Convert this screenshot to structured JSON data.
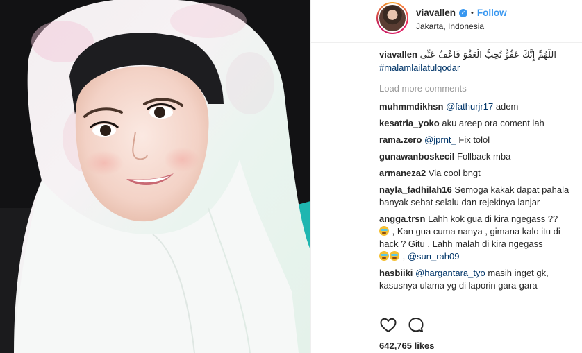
{
  "post": {
    "username": "viavallen",
    "verified_icon": "verified-badge-icon",
    "separator": "•",
    "follow_label": "Follow",
    "location": "Jakarta, Indonesia",
    "accent_color": "#3897f0"
  },
  "caption": {
    "user": "viavallen",
    "text": "اللَّهُمَّ إِنَّكَ عَفُوٌّ تُحِبُّ الْعَفْوَ فَاعْفُ عَنِّى",
    "hashtag": "#malamlailatulqodar"
  },
  "load_more_label": "Load more comments",
  "comments": [
    {
      "user": "muhmmdikhsn",
      "mention": "@fathurjr17",
      "text": " adem"
    },
    {
      "user": "kesatria_yoko",
      "mention": "",
      "text": "aku areep ora coment lah"
    },
    {
      "user": "rama.zero",
      "mention": "@jprnt_",
      "text": " Fix tolol"
    },
    {
      "user": "gunawanboskecil",
      "mention": "",
      "text": "Follback mba"
    },
    {
      "user": "armaneza2",
      "mention": "",
      "text": "Via cool bngt"
    },
    {
      "user": "nayla_fadhilah16",
      "mention": "",
      "text": "Semoga kakak dapat pahala banyak sehat selalu dan rejekinya lanjar"
    }
  ],
  "comment_angga": {
    "user": "angga.trsn",
    "text1": "Lahh kok gua di kira ngegass ??",
    "text2": " , Kan gua cuma nanya , gimana kalo itu di hack ? Gitu . Lahh malah di kira ngegass",
    "text3": " , ",
    "mention": "@sun_rah09"
  },
  "comment_hasbiiki": {
    "user": "hasbiiki",
    "mention": "@hargantara_tyo",
    "text": " masih inget gk, kasusnya ulama yg di laporin gara-gara"
  },
  "actions": {
    "like_icon": "heart-icon",
    "comment_icon": "comment-bubble-icon"
  },
  "likes_label": "642,765 likes"
}
